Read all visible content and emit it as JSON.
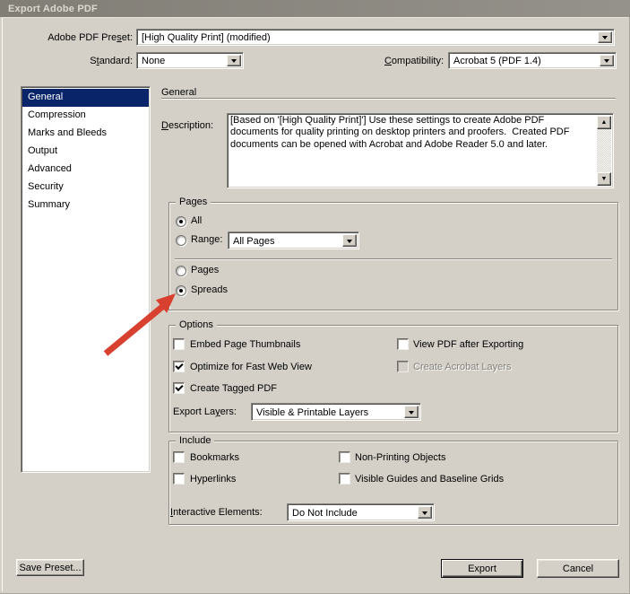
{
  "window": {
    "title": "Export Adobe PDF"
  },
  "colors": {
    "dialog_bg": "#d4d0c8",
    "titlebar_left": "#817e76",
    "titlebar_right": "#95928b",
    "selection_blue": "#0a246a",
    "arrow_red": "#d8402f"
  },
  "preset_row": {
    "label_pre": "Adobe PDF Pre",
    "label_key": "s",
    "label_post": "et:",
    "value": "[High Quality Print] (modified)"
  },
  "standard_row": {
    "label_pre": "S",
    "label_key": "t",
    "label_post": "andard:",
    "value": "None"
  },
  "compatibility_row": {
    "label_key": "C",
    "label_post": "ompatibility:",
    "value": "Acrobat 5 (PDF 1.4)"
  },
  "sidebar": {
    "items": [
      {
        "label": "General",
        "selected": true
      },
      {
        "label": "Compression",
        "selected": false
      },
      {
        "label": "Marks and Bleeds",
        "selected": false
      },
      {
        "label": "Output",
        "selected": false
      },
      {
        "label": "Advanced",
        "selected": false
      },
      {
        "label": "Security",
        "selected": false
      },
      {
        "label": "Summary",
        "selected": false
      }
    ]
  },
  "general": {
    "heading": "General",
    "description_label": {
      "label_key": "D",
      "label_post": "escription:"
    },
    "description_text": "[Based on '[High Quality Print]'] Use these settings to create Adobe PDF documents for quality printing on desktop printers and proofers.  Created PDF documents can be opened with Acrobat and Adobe Reader 5.0 and later.",
    "pages": {
      "legend": "Pages",
      "all_label": "All",
      "all_selected": true,
      "range_label": "Range:",
      "range_selected": false,
      "range_value": "All Pages",
      "pages_label": "Pages",
      "pages_selected": false,
      "spreads_label": "Spreads",
      "spreads_selected": true
    },
    "options": {
      "legend": "Options",
      "checks": [
        {
          "label": "Embed Page Thumbnails",
          "checked": false,
          "disabled": false
        },
        {
          "label": "Optimize for Fast Web View",
          "checked": true,
          "disabled": false
        },
        {
          "label": "Create Tagged PDF",
          "checked": true,
          "disabled": false
        },
        {
          "label": "View PDF after Exporting",
          "checked": false,
          "disabled": false
        },
        {
          "label": "Create Acrobat Layers",
          "checked": false,
          "disabled": true
        }
      ],
      "export_layers_label": {
        "pre": "Export La",
        "key": "y",
        "post": "ers:"
      },
      "export_layers_value": "Visible & Printable Layers"
    },
    "include": {
      "legend": "Include",
      "checks": [
        {
          "label": "Bookmarks",
          "checked": false
        },
        {
          "label": "Hyperlinks",
          "checked": false
        },
        {
          "label": "Non-Printing Objects",
          "checked": false
        },
        {
          "label": "Visible Guides and Baseline Grids",
          "checked": false
        }
      ],
      "interactive_label": {
        "key": "I",
        "post": "nteractive Elements:"
      },
      "interactive_value": "Do Not Include"
    }
  },
  "footer": {
    "save_preset": "Save Preset...",
    "export": "Export",
    "cancel": "Cancel"
  },
  "annotation": {
    "shape": "red-arrow",
    "points_at": "Spreads radio button"
  }
}
